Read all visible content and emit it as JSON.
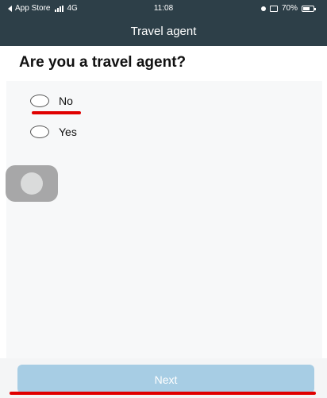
{
  "status_bar": {
    "carrier": "App Store",
    "network": "4G",
    "time": "11:08",
    "battery": "70%",
    "battery_level": 0.7
  },
  "nav": {
    "title": "Travel agent"
  },
  "question": {
    "text": "Are you a travel agent?"
  },
  "options": [
    {
      "label": "No",
      "selected": false
    },
    {
      "label": "Yes",
      "selected": false
    }
  ],
  "next_button": {
    "label": "Next",
    "enabled": false
  },
  "colors": {
    "header_bg": "#2d3f48",
    "button_disabled": "#a7cde4",
    "annotation_red": "#e00000"
  }
}
